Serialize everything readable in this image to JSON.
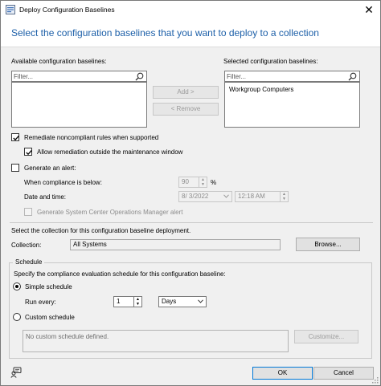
{
  "window": {
    "title": "Deploy Configuration Baselines",
    "header": "Select the configuration baselines that you want to deploy to a collection"
  },
  "available": {
    "label": "Available configuration baselines:",
    "filter_placeholder": "Filter..."
  },
  "selected": {
    "label": "Selected configuration baselines:",
    "filter_placeholder": "Filter...",
    "items": [
      "Workgroup Computers"
    ]
  },
  "buttons": {
    "add": "Add >",
    "remove": "< Remove",
    "browse": "Browse...",
    "customize": "Customize...",
    "ok": "OK",
    "cancel": "Cancel"
  },
  "options": {
    "remediate": {
      "label": "Remediate noncompliant rules when supported",
      "checked": true
    },
    "allow_outside": {
      "label": "Allow remediation outside the maintenance window",
      "checked": true
    },
    "generate_alert": {
      "label": "Generate an alert:",
      "checked": false
    },
    "compliance_label": "When compliance is below:",
    "compliance_value": "90",
    "percent": "%",
    "datetime_label": "Date and time:",
    "date_value": "8/  3/2022",
    "time_value": "12:18 AM",
    "scom_alert": "Generate System Center Operations Manager alert"
  },
  "collection": {
    "instruction": "Select the collection for this configuration baseline deployment.",
    "label": "Collection:",
    "value": "All Systems"
  },
  "schedule": {
    "legend": "Schedule",
    "instruction": "Specify the compliance evaluation schedule for this configuration baseline:",
    "simple_label": "Simple schedule",
    "run_every_label": "Run every:",
    "run_every_value": "1",
    "unit_value": "Days",
    "custom_label": "Custom schedule",
    "custom_text": "No custom schedule defined."
  }
}
